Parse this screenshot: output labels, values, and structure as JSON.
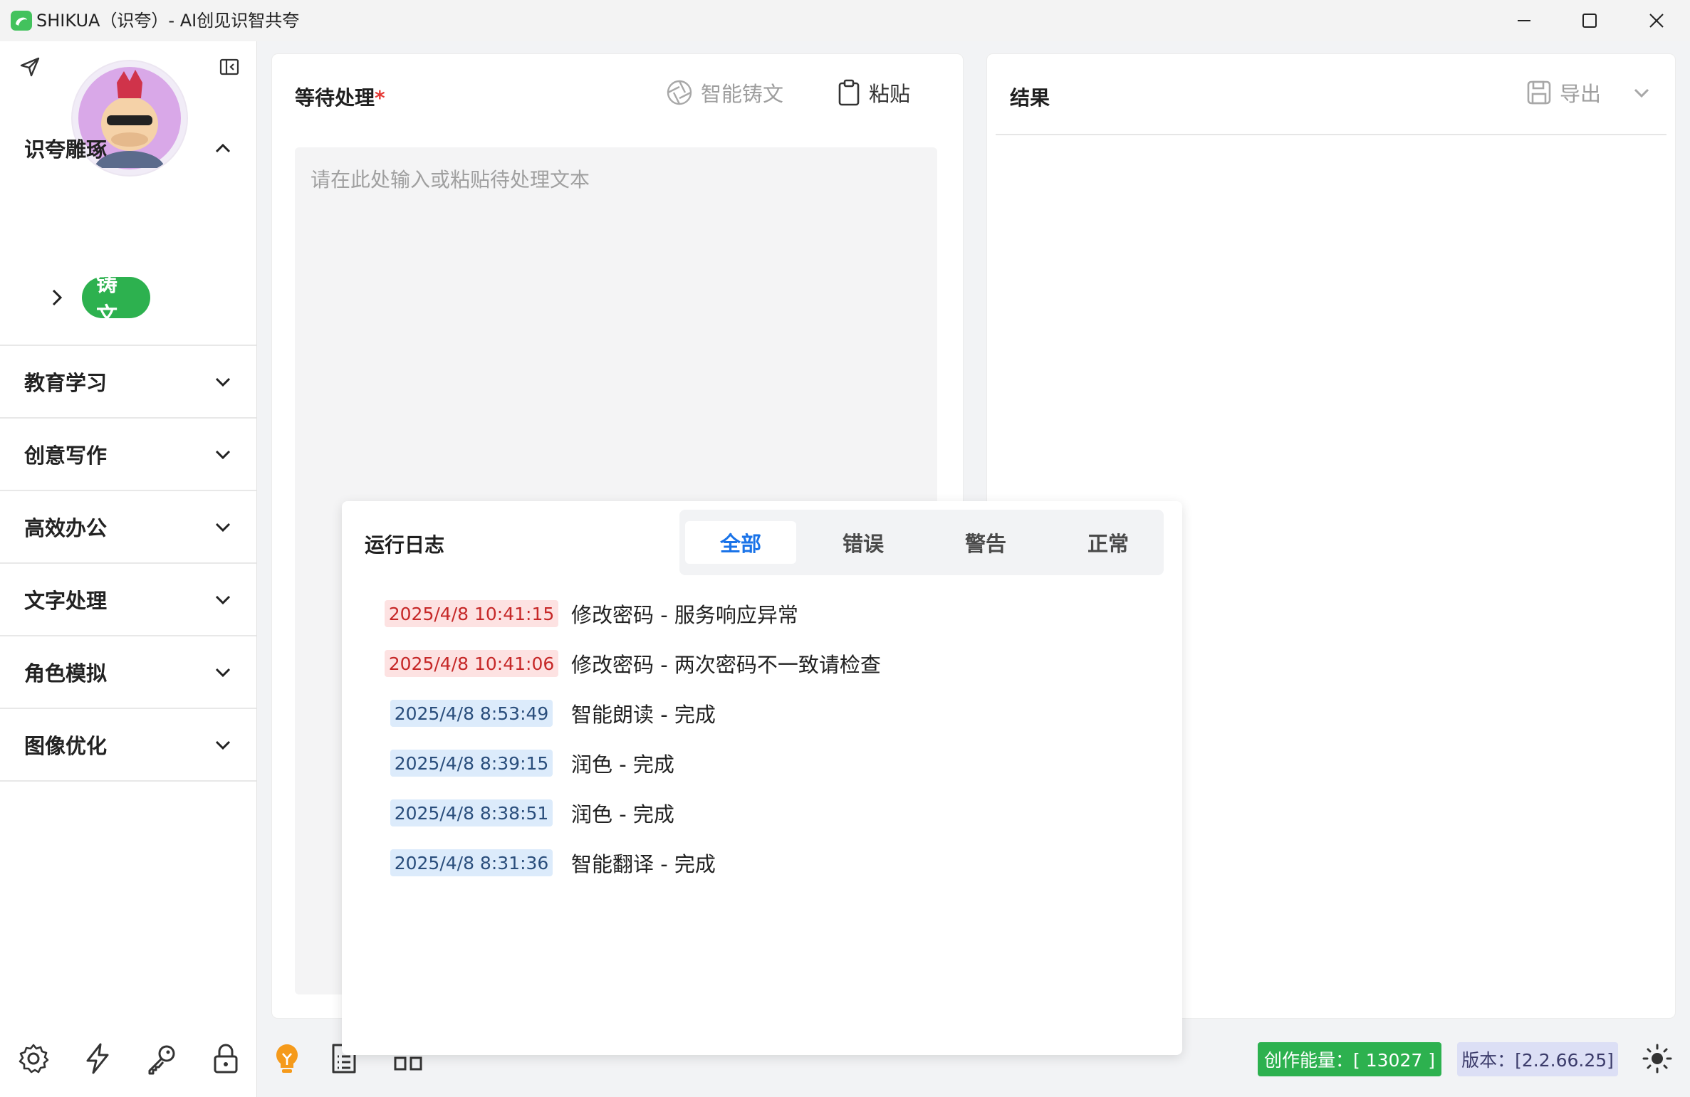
{
  "window": {
    "title": "SHIKUA（识夸）- AI创见识智共夸"
  },
  "sidebar": {
    "groups": [
      {
        "label": "识夸雕琢",
        "expanded": true
      },
      {
        "label": "教育学习",
        "expanded": false
      },
      {
        "label": "创意写作",
        "expanded": false
      },
      {
        "label": "高效办公",
        "expanded": false
      },
      {
        "label": "文字处理",
        "expanded": false
      },
      {
        "label": "角色模拟",
        "expanded": false
      },
      {
        "label": "图像优化",
        "expanded": false
      }
    ],
    "active_item": "铸文",
    "icons": [
      "send-icon",
      "collapse-sidebar-icon"
    ]
  },
  "input_panel": {
    "title": "等待处理",
    "required_mark": "*",
    "smart_button": "智能铸文",
    "paste_button": "粘贴",
    "placeholder": "请在此处输入或粘贴待处理文本"
  },
  "result_panel": {
    "title": "结果",
    "export_button": "导出"
  },
  "log": {
    "title": "运行日志",
    "tabs": [
      "全部",
      "错误",
      "警告",
      "正常"
    ],
    "active_tab": "全部",
    "entries": [
      {
        "time": "2025/4/8 10:41:15",
        "message": "修改密码 - 服务响应异常",
        "level": "error"
      },
      {
        "time": "2025/4/8 10:41:06",
        "message": "修改密码 - 两次密码不一致请检查",
        "level": "error"
      },
      {
        "time": "2025/4/8 8:53:49",
        "message": "智能朗读 - 完成",
        "level": "normal"
      },
      {
        "time": "2025/4/8 8:39:15",
        "message": "润色 - 完成",
        "level": "normal"
      },
      {
        "time": "2025/4/8 8:38:51",
        "message": "润色 - 完成",
        "level": "normal"
      },
      {
        "time": "2025/4/8 8:31:36",
        "message": "智能翻译 - 完成",
        "level": "normal"
      }
    ]
  },
  "footer": {
    "energy": "创作能量：[ 13027 ]",
    "version": "版本：[2.2.66.25]",
    "icons": [
      "settings-icon",
      "lightning-icon",
      "key-icon",
      "lock-icon",
      "lightbulb-icon",
      "list-icon",
      "layout-icon",
      "theme-sun-icon"
    ]
  },
  "colors": {
    "accent_green": "#2db14f",
    "tab_active_blue": "#1a73e8",
    "error_bg": "#fde2e2",
    "normal_bg": "#dcebfb"
  }
}
